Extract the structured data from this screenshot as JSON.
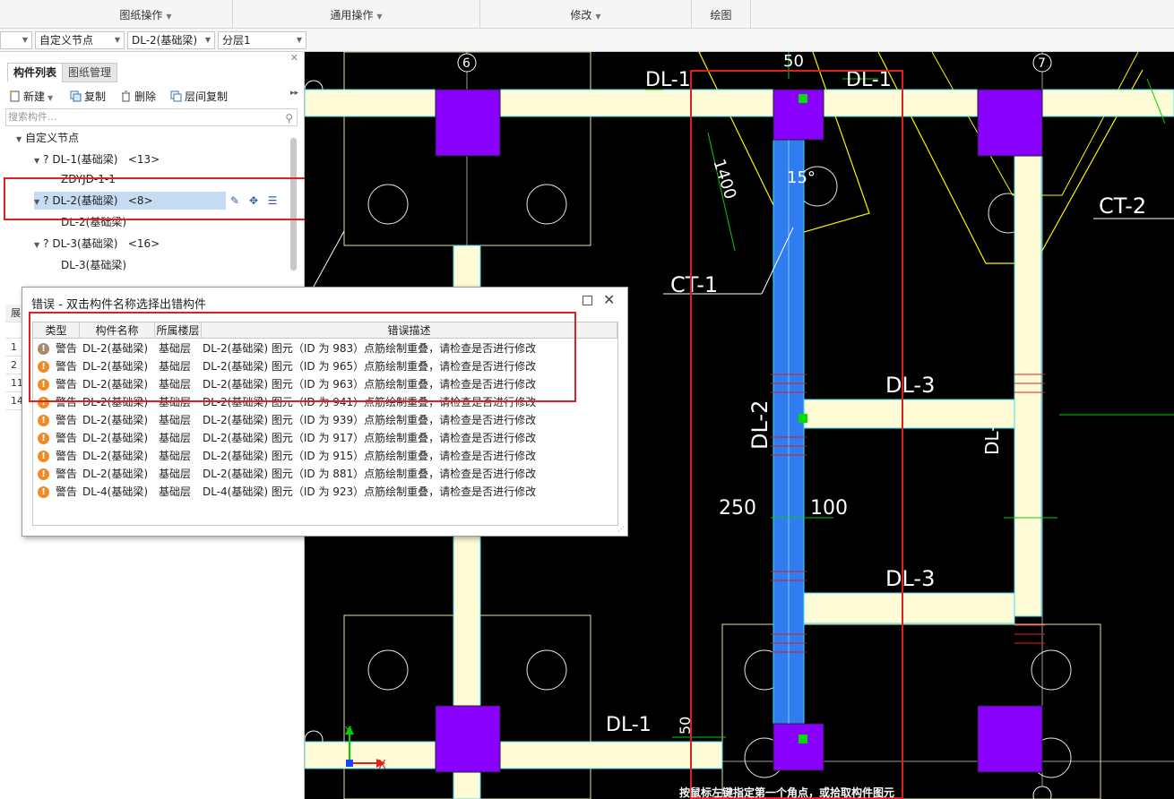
{
  "ribbon": {
    "groups": [
      {
        "label": "图纸操作",
        "has_menu": true
      },
      {
        "label": "通用操作",
        "has_menu": true
      },
      {
        "label": "修改",
        "has_menu": true
      },
      {
        "label": "绘图",
        "has_menu": false
      }
    ]
  },
  "selectors": {
    "node_type": "自定义节点",
    "component": "DL-2(基础梁)",
    "layer": "分层1"
  },
  "left_panel": {
    "tabs": [
      "构件列表",
      "图纸管理"
    ],
    "active_tab": "构件列表",
    "actions": {
      "new": "新建",
      "copy": "复制",
      "delete": "删除",
      "floor_copy": "层间复制"
    },
    "search_placeholder": "搜索构件...",
    "tree": {
      "root": "自定义节点",
      "items": [
        {
          "label": "? DL-1(基础梁)",
          "count": "<13>",
          "child": "ZDYJD-1-1"
        },
        {
          "label": "? DL-2(基础梁)",
          "count": "<8>",
          "child": "DL-2(基础梁)",
          "selected": true
        },
        {
          "label": "? DL-3(基础梁)",
          "count": "<16>",
          "child": "DL-3(基础梁)"
        }
      ]
    },
    "side_grid": {
      "header": "展",
      "rows": [
        "1",
        "2",
        "11",
        "14"
      ]
    }
  },
  "dialog": {
    "title": "错误 - 双击构件名称选择出错构件",
    "columns": [
      "类型",
      "构件名称",
      "所属楼层",
      "错误描述"
    ],
    "rows": [
      {
        "type": "警告",
        "name": "DL-2(基础梁)",
        "floor": "基础层",
        "desc": "DL-2(基础梁)  图元（ID 为 983）点筋绘制重叠，请检查是否进行修改",
        "dim": true
      },
      {
        "type": "警告",
        "name": "DL-2(基础梁)",
        "floor": "基础层",
        "desc": "DL-2(基础梁)  图元（ID 为 965）点筋绘制重叠，请检查是否进行修改"
      },
      {
        "type": "警告",
        "name": "DL-2(基础梁)",
        "floor": "基础层",
        "desc": "DL-2(基础梁)  图元（ID 为 963）点筋绘制重叠，请检查是否进行修改"
      },
      {
        "type": "警告",
        "name": "DL-2(基础梁)",
        "floor": "基础层",
        "desc": "DL-2(基础梁)  图元（ID 为 941）点筋绘制重叠，请检查是否进行修改"
      },
      {
        "type": "警告",
        "name": "DL-2(基础梁)",
        "floor": "基础层",
        "desc": "DL-2(基础梁)  图元（ID 为 939）点筋绘制重叠，请检查是否进行修改"
      },
      {
        "type": "警告",
        "name": "DL-2(基础梁)",
        "floor": "基础层",
        "desc": "DL-2(基础梁)  图元（ID 为 917）点筋绘制重叠，请检查是否进行修改"
      },
      {
        "type": "警告",
        "name": "DL-2(基础梁)",
        "floor": "基础层",
        "desc": "DL-2(基础梁)  图元（ID 为 915）点筋绘制重叠，请检查是否进行修改"
      },
      {
        "type": "警告",
        "name": "DL-2(基础梁)",
        "floor": "基础层",
        "desc": "DL-2(基础梁)  图元（ID 为 881）点筋绘制重叠，请检查是否进行修改"
      },
      {
        "type": "警告",
        "name": "DL-4(基础梁)",
        "floor": "基础层",
        "desc": "DL-4(基础梁)  图元（ID 为 923）点筋绘制重叠，请检查是否进行修改"
      }
    ]
  },
  "canvas": {
    "labels": {
      "axis_6": "6",
      "axis_7": "7",
      "dl1": "DL-1",
      "dl2": "DL-2",
      "dl3": "DL-3",
      "ct1": "CT-1",
      "ct2": "CT-2",
      "dim_1400": "1400",
      "dim_250": "250",
      "dim_100": "100",
      "dim_50": "50",
      "angle_15": "15°",
      "axis_x": "X",
      "axis_y": "Y"
    },
    "status_text": "按鼠标左键指定第一个角点，或拾取构件图元"
  },
  "colors": {
    "beam_fill": "#fffbd6",
    "beam_outline": "#36e0ff",
    "column": "#8a00ff",
    "selected_beam": "#2f7df0",
    "highlight_red": "#e02020",
    "foundation_line": "#fff200",
    "grip_green": "#00e000"
  }
}
